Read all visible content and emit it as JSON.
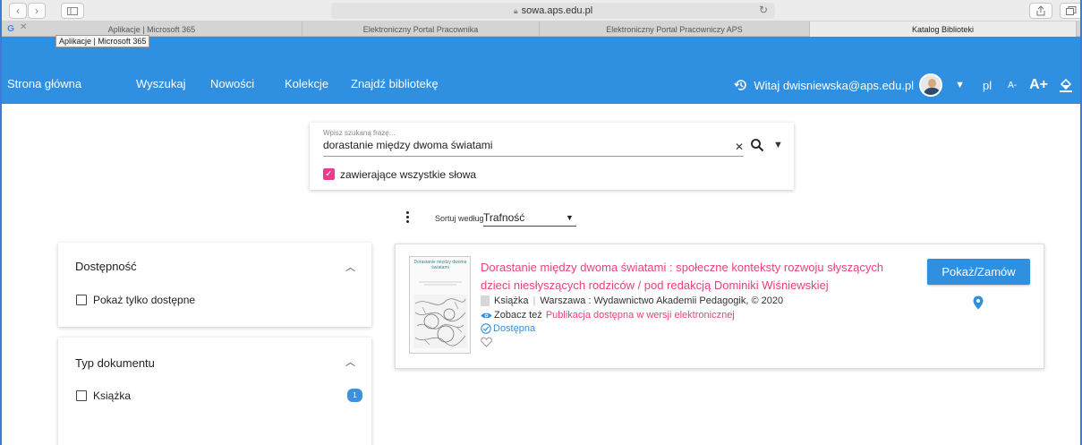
{
  "browser": {
    "url": "sowa.aps.edu.pl",
    "tabs": [
      {
        "label": "Aplikacje | Microsoft 365"
      },
      {
        "label": "Elektroniczny Portal Pracownika"
      },
      {
        "label": "Elektroniczny Portal Pracowniczy APS"
      },
      {
        "label": "Katalog Biblioteki"
      }
    ],
    "tooltip": "Aplikacje | Microsoft 365"
  },
  "nav": {
    "items": [
      "Strona główna",
      "Wyszukaj",
      "Nowości",
      "Kolekcje",
      "Znajdź bibliotekę"
    ],
    "greeting": "Witaj dwisniewska@aps.edu.pl",
    "language": "pl",
    "font_smaller": "A-",
    "font_larger": "A+",
    "color": "#2f8fe0"
  },
  "search": {
    "placeholder": "Wpisz szukaną frazę...",
    "value": "dorastanie między dwoma światami",
    "all_words_label": "zawierające wszystkie słowa",
    "all_words_checked": true
  },
  "sort": {
    "label": "Sortuj według",
    "value": "Trafność"
  },
  "facets": {
    "availability": {
      "title": "Dostępność",
      "option": "Pokaż tylko dostępne"
    },
    "doc_type": {
      "title": "Typ dokumentu",
      "option": "Książka",
      "count": "1"
    }
  },
  "result": {
    "cover_title": "Dorastanie między dwoma światami",
    "title": "Dorastanie między dwoma światami : społeczne konteksty rozwoju słyszących dzieci niesłyszących rodziców / pod redakcją Dominiki Wiśniewskiej",
    "type": "Książka",
    "publisher": "Warszawa : Wydawnictwo Akademii Pedagogik, © 2020",
    "see_also_label": "Zobacz też",
    "see_also_link": "Publikacja dostępna w wersji elektronicznej",
    "availability": "Dostępna",
    "button": "Pokaż/Zamów",
    "accent": "#e8417e"
  }
}
